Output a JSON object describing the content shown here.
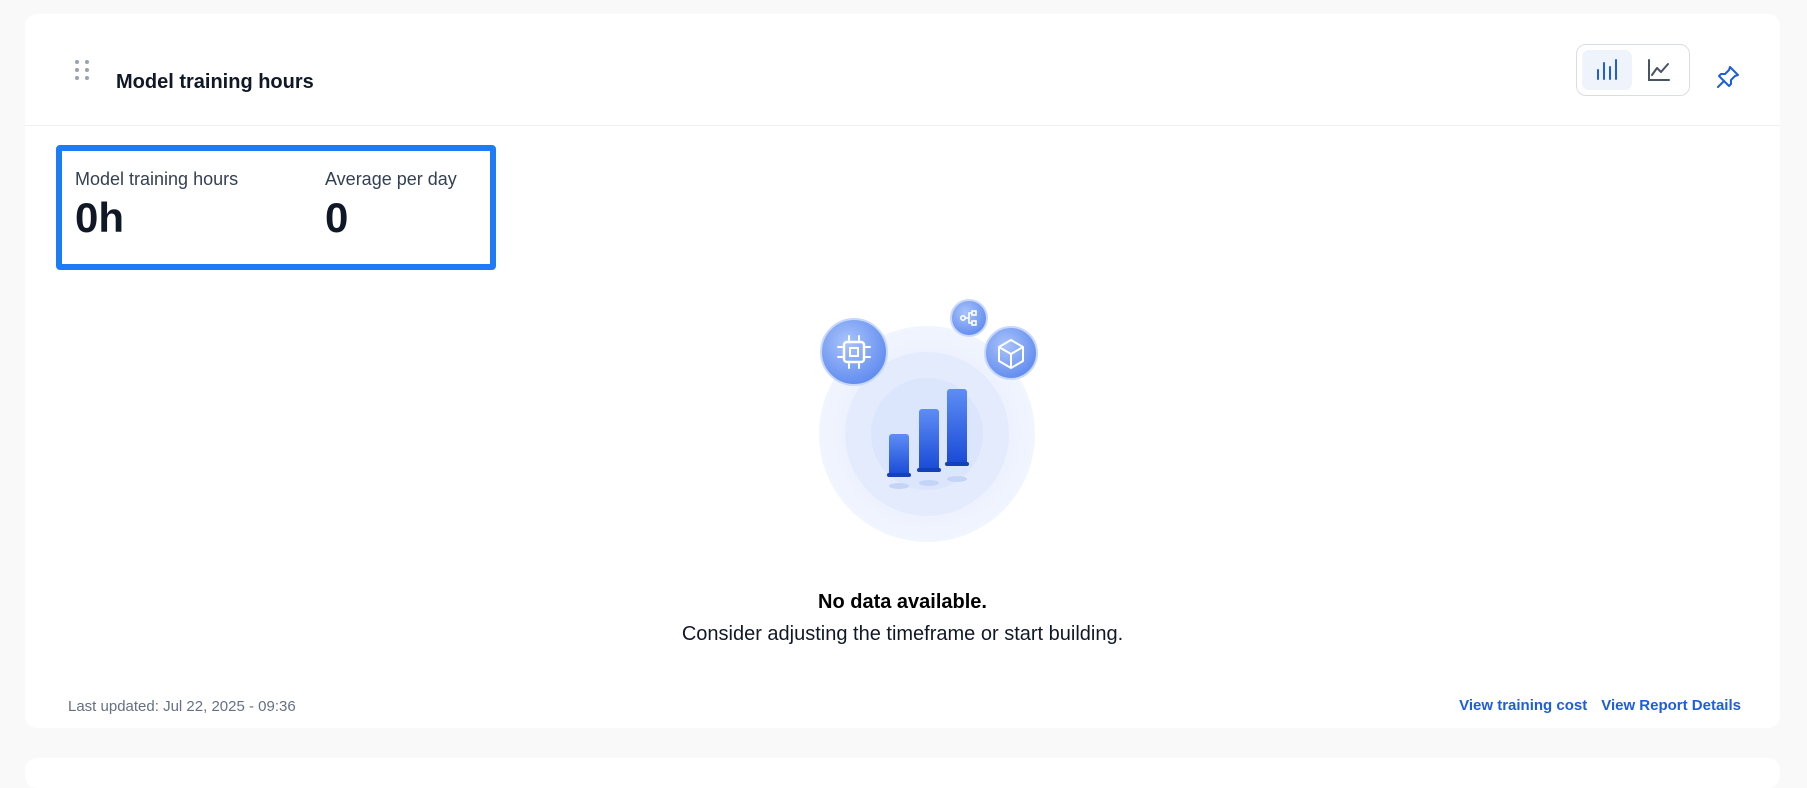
{
  "card": {
    "title": "Model training hours"
  },
  "view_toggle": {
    "options": [
      {
        "name": "bar-chart-view",
        "icon": "bar-chart-icon",
        "active": true
      },
      {
        "name": "line-chart-view",
        "icon": "line-chart-icon",
        "active": false
      }
    ]
  },
  "pin": {
    "icon": "pin-icon"
  },
  "stats": [
    {
      "label": "Model training hours",
      "value": "0h"
    },
    {
      "label": "Average per day",
      "value": "0"
    }
  ],
  "empty_state": {
    "title": "No data available.",
    "subtitle": "Consider adjusting the timeframe or start building.",
    "icons": [
      "chip-icon",
      "workflow-icon",
      "cube-icon",
      "bar-chart-illustration"
    ]
  },
  "footer": {
    "last_updated": "Last updated: Jul 22, 2025 - 09:36",
    "links": [
      "View training cost",
      "View Report Details"
    ]
  },
  "colors": {
    "accent": "#1d7bf5",
    "link": "#1d5ede",
    "background": "#f9f9f9"
  }
}
